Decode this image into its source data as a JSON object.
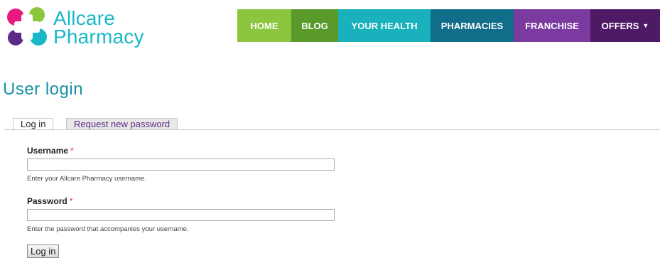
{
  "brand": {
    "name_line1": "Allcare",
    "name_line2": "Pharmacy"
  },
  "nav": {
    "items": [
      {
        "label": "HOME",
        "color": "#8cc63f"
      },
      {
        "label": "BLOG",
        "color": "#5a9a2b"
      },
      {
        "label": "YOUR HEALTH",
        "color": "#18b1bc"
      },
      {
        "label": "PHARMACIES",
        "color": "#106e8a"
      },
      {
        "label": "FRANCHISE",
        "color": "#7a3aa0"
      },
      {
        "label": "OFFERS",
        "color": "#4e1a66",
        "has_dropdown": true
      }
    ]
  },
  "page": {
    "title": "User login"
  },
  "tabs": [
    {
      "label": "Log in",
      "active": true
    },
    {
      "label": "Request new password",
      "active": false
    }
  ],
  "form": {
    "username": {
      "label": "Username",
      "required_mark": "*",
      "value": "",
      "description": "Enter your Allcare Pharmacy username."
    },
    "password": {
      "label": "Password",
      "required_mark": "*",
      "value": "",
      "description": "Enter the password that accompanies your username."
    },
    "submit_label": "Log in"
  },
  "colors": {
    "title": "#1a8fa3",
    "brand_text": "#1ab7c8",
    "required": "#e0312f",
    "tab_link": "#5a2c84"
  },
  "icons": {
    "logo": "allcare-logo-icon",
    "dropdown": "caret-down-icon"
  }
}
